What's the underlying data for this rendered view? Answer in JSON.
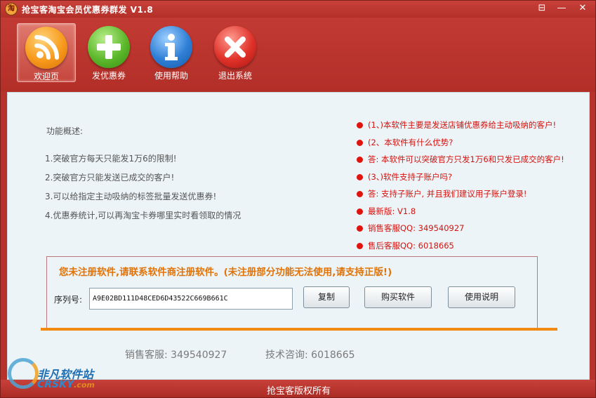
{
  "window": {
    "title": "抢宝客淘宝会员优惠券群发 V1.8",
    "app_icon_glyph": "淘",
    "min_glyph": "—",
    "close_glyph": "✕",
    "settings_glyph": "⊟"
  },
  "toolbar": {
    "items": [
      {
        "label": "欢迎页",
        "icon": "rss-icon",
        "active": true
      },
      {
        "label": "发优惠券",
        "icon": "plus-icon",
        "active": false
      },
      {
        "label": "使用帮助",
        "icon": "info-icon",
        "active": false
      },
      {
        "label": "退出系统",
        "icon": "close-x-icon",
        "active": false
      }
    ]
  },
  "features": {
    "title": "功能概述:",
    "items": [
      "1.突破官方每天只能发1万6的限制!",
      "2.突破官方只能发送已成交的客户!",
      "3.可以给指定主动吸纳的标签批量发送优惠券!",
      "4.优惠券统计,可以再淘宝卡券哪里实时看领取的情况"
    ]
  },
  "faq": [
    "(1、)本软件主要是发送店铺优惠券给主动吸纳的客户!",
    "(2、本软件有什么优势?",
    "答: 本软件可以突破官方只发1万6和只发已成交的客户!",
    "(3、)软件支持子账户吗?",
    "答: 支持子账户, 并且我们建议用子账户登录!",
    "最新版: V1.8",
    "销售客服QQ: 349540927",
    "售后客服QQ: 6018665"
  ],
  "register": {
    "warning": "您未注册软件,请联系软件商注册软件。(未注册部分功能无法使用,请支持正版!)",
    "serial_label": "序列号:",
    "serial_value": "A9E02BD111D48CED6D43522C669B661C",
    "copy_button": "复制",
    "buy_button": "购买软件",
    "manual_button": "使用说明"
  },
  "contact": {
    "sales": "销售客服: 349540927",
    "tech": "技术咨询: 6018665"
  },
  "statusbar": {
    "copyright": "抢宝客版权所有"
  },
  "watermark": {
    "cn": "非凡软件站",
    "en": "CRSKY",
    "com": ".com"
  },
  "colors": {
    "frame": "#b8322c",
    "panel": "#ecf4f7",
    "faq_text": "#d3130f",
    "warning": "#e07309",
    "divider": "#f28a12"
  }
}
